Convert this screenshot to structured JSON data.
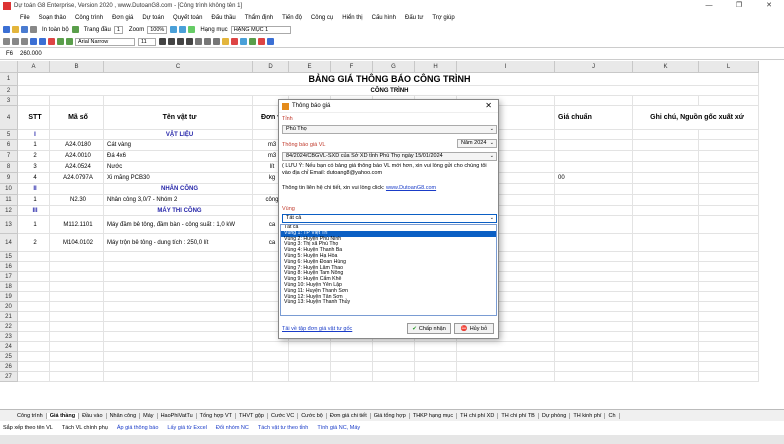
{
  "window": {
    "title": "Dự toán G8 Enterprise, Version 2020 , www.DutoanG8.com - [Công trình không tên 1]"
  },
  "menu": [
    "File",
    "Soạn thảo",
    "Công trình",
    "Đơn giá",
    "Dự toán",
    "Quyết toán",
    "Đấu thầu",
    "Thẩm định",
    "Tiến độ",
    "Công cụ",
    "Hiển thị",
    "Cấu hình",
    "Đấu tư",
    "Trợ giúp"
  ],
  "toolbar": {
    "in_toan_bo": "In toàn bộ",
    "trang_dau": "Trang đầu",
    "trang_dau_val": "1",
    "zoom_label": "Zoom",
    "zoom_val": "100%",
    "hang_muc_label": "Hạng mục",
    "hang_muc_val": "HẠNG MỤC 1",
    "font": "Arial Narrow",
    "size": "11"
  },
  "formula": {
    "ref": "F6",
    "value": "260.000"
  },
  "columns": [
    "A",
    "B",
    "C",
    "D",
    "E",
    "F",
    "G",
    "H",
    "I",
    "J",
    "K",
    "L"
  ],
  "rows": [
    "1",
    "2",
    "3",
    "4",
    "5",
    "6",
    "7",
    "8",
    "9",
    "10",
    "11",
    "12",
    "13",
    "14",
    "15",
    "16",
    "17",
    "18",
    "19",
    "20",
    "21",
    "22",
    "23",
    "24",
    "25",
    "26",
    "27"
  ],
  "sheet": {
    "title": "BẢNG GIÁ THÔNG BÁO CÔNG TRÌNH",
    "subtitle": "CÔNG TRÌNH",
    "headers": {
      "stt": "STT",
      "ma_so": "Mã số",
      "ten": "Tên vật tư",
      "dvt": "Đơn vị",
      "chuan": "Giá chuẩn",
      "ghichu": "Ghi chú, Nguồn gốc xuất xứ"
    },
    "r5": {
      "a": "I",
      "c": "VẬT LIỆU"
    },
    "r6": {
      "a": "1",
      "b": "A24.0180",
      "c": "Cát vàng",
      "d": "m3"
    },
    "r7": {
      "a": "2",
      "b": "A24.0010",
      "c": "Đá 4x6",
      "d": "m3"
    },
    "r8": {
      "a": "3",
      "b": "A24.0524",
      "c": "Nước",
      "d": "lít"
    },
    "r9": {
      "a": "4",
      "b": "A24.0797A",
      "c": "Xi măng PCB30",
      "d": "kg",
      "j": "00"
    },
    "r10": {
      "a": "II",
      "c": "NHÂN CÔNG"
    },
    "r11": {
      "a": "1",
      "b": "N2.30",
      "c": "Nhân công 3,0/7 - Nhóm 2",
      "d": "công"
    },
    "r12": {
      "a": "III",
      "c": "MÁY THI CÔNG"
    },
    "r13": {
      "a": "1",
      "b": "M112.1101",
      "c": "Máy đầm bê tông, đầm bàn - công suất : 1,0 kW",
      "d": "ca"
    },
    "r14": {
      "a": "2",
      "b": "M104.0102",
      "c": "Máy trộn bê tông - dung tích : 250,0 lít",
      "d": "ca"
    }
  },
  "dialog": {
    "title": "Thông báo giá",
    "tinh_label": "Tỉnh",
    "tinh_val": "Phú Thọ",
    "tbg_label": "Thông báo giá VL",
    "nam": "Năm 2024",
    "tbg_val": "84/2024/CBGVL-SXD của Sở XD tỉnh Phú Thọ ngày 15/01/2024",
    "note1": "( LƯU Ý: Nếu bạn có bảng giá thông báo VL mới hơn, xin vui lòng gửi cho chúng tôi vào địa chỉ Email:  dutoang8@yahoo.com",
    "note2": "Thông tin liên hệ chi tiết, xin vui lòng click: ",
    "note2_link": "www.DutoanG8.com",
    "vung_label": "Vùng",
    "vung_val": "Tất cả",
    "vung_options": [
      "Tất cả",
      "Vùng 1: TP Việt Trì",
      "Vùng 2: Huyện Phù Ninh",
      "Vùng 3: Thị xã Phú Thọ",
      "Vùng 4: Huyện Thanh Ba",
      "Vùng 5: Huyện Hạ Hòa",
      "Vùng 6: Huyện Đoan Hùng",
      "Vùng 7: Huyện Lâm Thao",
      "Vùng 8: Huyện Tam Nông",
      "Vùng 9: Huyện Cẩm Khê",
      "Vùng 10: Huyện Yên Lập",
      "Vùng 11: Huyện Thanh Sơn",
      "Vùng 12: Huyện Tân Sơn",
      "Vùng 13: Huyện Thanh Thủy"
    ],
    "download": "Tải về tập đơn giá vật tư gốc",
    "ok": "Chấp nhận",
    "cancel": "Hủy bỏ"
  },
  "tabs": [
    "Công trình",
    "Giá thầng",
    "Đầu vào",
    "Nhân công",
    "Máy",
    "HaoPhiVatTu",
    "Tổng hợp VT",
    "THVT gộp",
    "Cước VC",
    "Cước bộ",
    "Đơn giá chi tiết",
    "Giá tổng hợp",
    "THKP hạng mục",
    "TH chi phí XD",
    "TH chi phí TB",
    "Dự phòng",
    "TH kinh phí",
    "Ch"
  ],
  "status": [
    "Sắp xếp theo tên VL",
    "Tách VL chính phụ",
    "Áp giá thông báo",
    "Lấy giá từ Excel",
    "Đổi nhóm NC",
    "Tách vật tư theo tỉnh",
    "Tính giá NC, Máy"
  ]
}
